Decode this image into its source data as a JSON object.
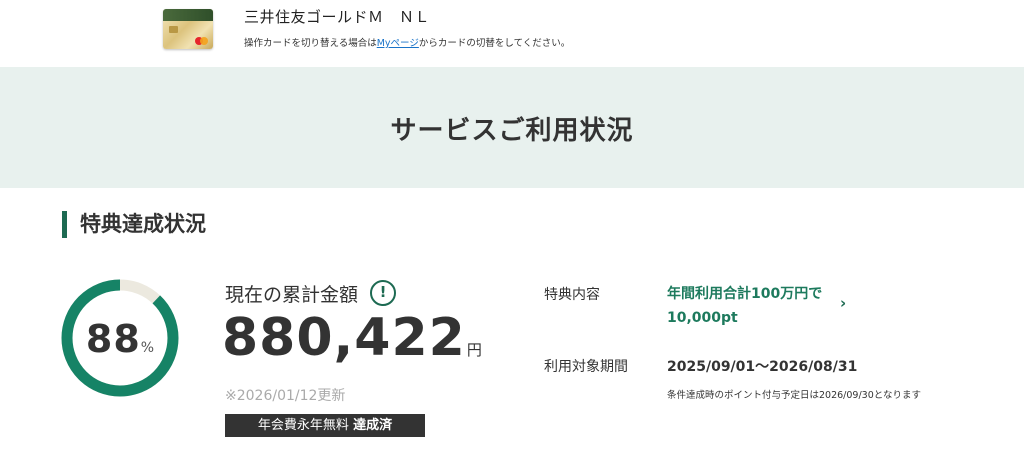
{
  "card": {
    "name": "三井住友ゴールドＭ　ＮＬ",
    "note_before": "操作カードを切り替える場合は",
    "note_link": "Myページ",
    "note_after": "からカードの切替をしてください。"
  },
  "page": {
    "title": "サービスご利用状況"
  },
  "section": {
    "title": "特典達成状況"
  },
  "progress": {
    "percent": 88,
    "value_text": "88",
    "unit": "%",
    "ring_color": "#168366",
    "track_color": "#ece9df"
  },
  "amount": {
    "label": "現在の累計金額",
    "info_icon": "!",
    "value": "880,422",
    "unit": "円",
    "updated": "※2026/01/12更新",
    "badge_normal": "年会費永年無料",
    "badge_strong": "達成済"
  },
  "benefit": {
    "label": "特典内容",
    "line1": "年間利用合計100万円で",
    "line2": "10,000pt",
    "chevron": "›",
    "period_label": "利用対象期間",
    "period_value": "2025/09/01～2026/08/31",
    "note": "条件達成時のポイント付与予定日は2026/09/30となります"
  },
  "colors": {
    "accent": "#1d6a52",
    "band": "#e8f1ee",
    "link": "#1a73c8"
  }
}
